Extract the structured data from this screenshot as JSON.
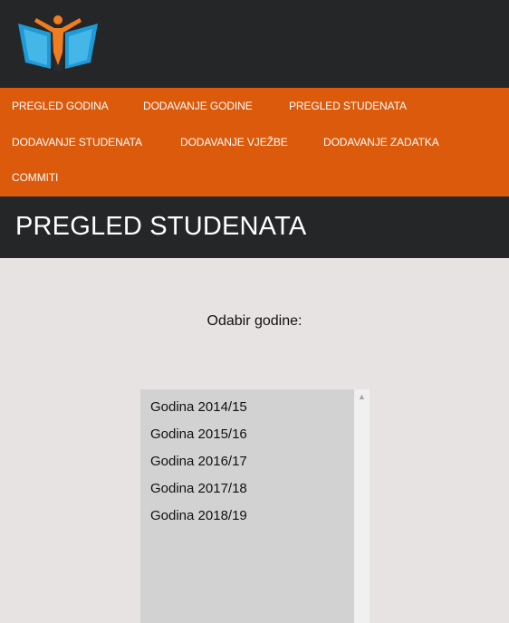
{
  "brand": {
    "logo_icon": "book-person-logo",
    "colors": {
      "header_bg": "#252628",
      "nav_bg": "#db5a0b",
      "page_bg": "#e6e3e2",
      "logo_blue": "#1e9ad6",
      "logo_orange": "#f07d1f"
    }
  },
  "nav": {
    "items": [
      {
        "label": "PREGLED GODINA"
      },
      {
        "label": "DODAVANJE GODINE"
      },
      {
        "label": "PREGLED STUDENATA"
      },
      {
        "label": "DODAVANJE STUDENATA"
      },
      {
        "label": "DODAVANJE VJEŽBE"
      },
      {
        "label": "DODAVANJE ZADATKA"
      },
      {
        "label": "COMMITI"
      }
    ]
  },
  "page": {
    "title": "PREGLED STUDENATA"
  },
  "year_select": {
    "label": "Odabir godine:",
    "options": [
      "Godina 2014/15",
      "Godina 2015/16",
      "Godina 2016/17",
      "Godina 2017/18",
      "Godina 2018/19"
    ],
    "scroll_up_icon": "chevron-up-icon"
  }
}
